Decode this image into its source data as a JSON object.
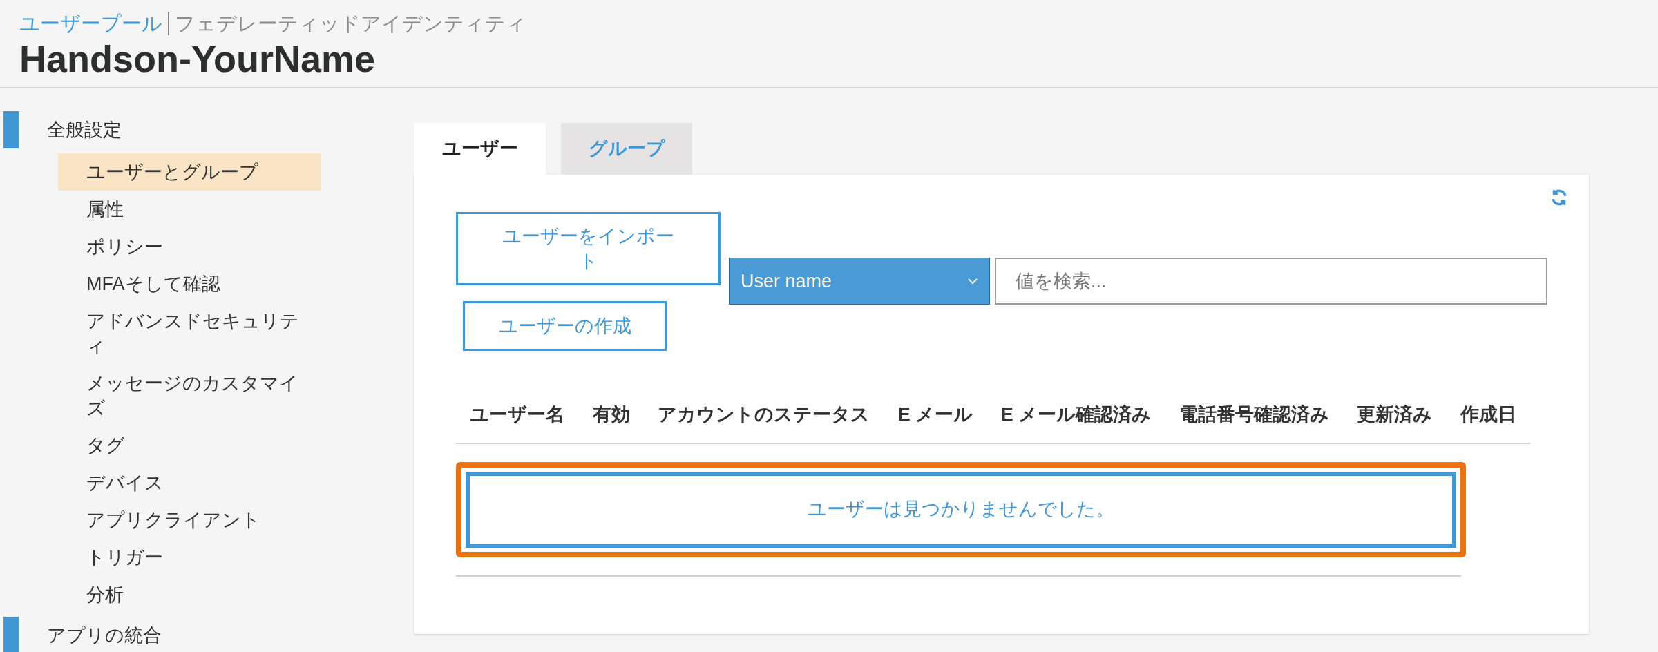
{
  "breadcrumb": [
    {
      "label": "ユーザープール",
      "link": true
    },
    {
      "label": "フェデレーティッドアイデンティティ",
      "link": false
    }
  ],
  "title": "Handson-YourName",
  "sidebar": {
    "sections": [
      {
        "label": "全般設定",
        "children": [
          {
            "label": "ユーザーとグループ",
            "selected": true
          },
          {
            "label": "属性",
            "selected": false
          },
          {
            "label": "ポリシー",
            "selected": false
          },
          {
            "label": "MFAそして確認",
            "selected": false
          },
          {
            "label": "アドバンスドセキュリティ",
            "selected": false
          },
          {
            "label": "メッセージのカスタマイズ",
            "selected": false
          },
          {
            "label": "タグ",
            "selected": false
          },
          {
            "label": "デバイス",
            "selected": false
          },
          {
            "label": "アプリクライアント",
            "selected": false
          },
          {
            "label": "トリガー",
            "selected": false
          },
          {
            "label": "分析",
            "selected": false
          }
        ]
      },
      {
        "label": "アプリの統合"
      }
    ]
  },
  "tabs": [
    {
      "label": "ユーザー",
      "selected": true
    },
    {
      "label": "グループ",
      "selected": false
    }
  ],
  "buttons": {
    "import": "ユーザーをインポート",
    "create": "ユーザーの作成"
  },
  "filter": {
    "value": "User name"
  },
  "search": {
    "placeholder": "値を検索..."
  },
  "table": {
    "columns": [
      "ユーザー名",
      "有効",
      "アカウントのステータス",
      "E メール",
      "E メール確認済み",
      "電話番号確認済み",
      "更新済み",
      "作成日"
    ]
  },
  "empty_state": {
    "message": "ユーザーは見つかりませんでした。",
    "highlighted": true
  }
}
